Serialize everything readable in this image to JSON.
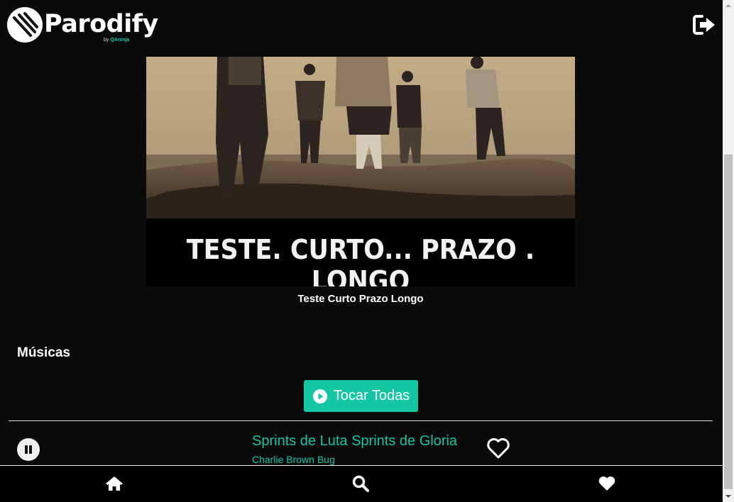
{
  "header": {
    "logo_text": "Parodify",
    "logo_sub_by": "by",
    "logo_sub_brand": "QAninja",
    "logout_icon": "sign-out-icon"
  },
  "album": {
    "cover_text": "TESTE. CURTO... PRAZO . LONGO",
    "name": "Teste Curto Prazo Longo"
  },
  "songs_section": {
    "title": "Músicas",
    "play_all_label": "Tocar Todas",
    "play_all_icon": "play-circle-icon"
  },
  "songs": [
    {
      "title": "Sprints de Luta Sprints de Gloria",
      "artist": "Charlie Brown Bug",
      "state_icon": "pause-icon",
      "favorite_icon": "heart-outline-icon"
    }
  ],
  "footer": {
    "items": [
      {
        "icon": "home-icon"
      },
      {
        "icon": "search-icon"
      },
      {
        "icon": "heart-icon"
      }
    ]
  },
  "colors": {
    "background": "#0b0a0b",
    "accent": "#14c7a3",
    "text": "#ffffff"
  }
}
